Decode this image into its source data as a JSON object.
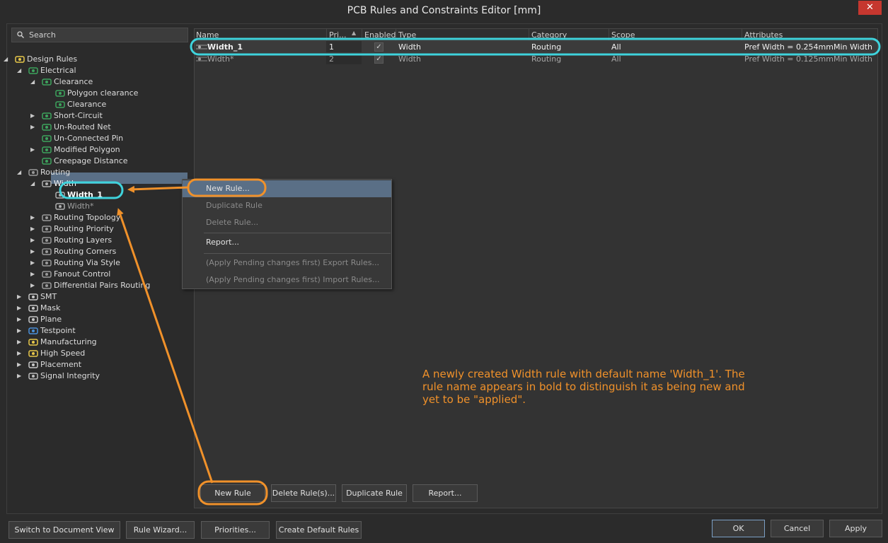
{
  "window": {
    "title": "PCB Rules and Constraints Editor [mm]",
    "close_glyph": "✕"
  },
  "search": {
    "label": "Search"
  },
  "tree": [
    {
      "label": "Design Rules",
      "icon": "design-rules-icon"
    },
    {
      "label": "Electrical",
      "icon": "electrical-icon"
    },
    {
      "label": "Clearance",
      "icon": "clearance-icon"
    },
    {
      "label": "Polygon clearance",
      "icon": "clearance-icon"
    },
    {
      "label": "Clearance",
      "icon": "clearance-icon"
    },
    {
      "label": "Short-Circuit",
      "icon": "short-circuit-icon"
    },
    {
      "label": "Un-Routed Net",
      "icon": "unrouted-net-icon"
    },
    {
      "label": "Un-Connected Pin",
      "icon": "unconnected-pin-icon"
    },
    {
      "label": "Modified Polygon",
      "icon": "modified-polygon-icon"
    },
    {
      "label": "Creepage Distance",
      "icon": "creepage-icon"
    },
    {
      "label": "Routing",
      "icon": "routing-icon"
    },
    {
      "label": "Width",
      "icon": "width-icon"
    },
    {
      "label": "Width_1",
      "icon": "width-icon"
    },
    {
      "label": "Width*",
      "icon": "width-icon"
    },
    {
      "label": "Routing Topology",
      "icon": "routing-icon"
    },
    {
      "label": "Routing Priority",
      "icon": "routing-icon"
    },
    {
      "label": "Routing Layers",
      "icon": "routing-icon"
    },
    {
      "label": "Routing Corners",
      "icon": "routing-icon"
    },
    {
      "label": "Routing Via Style",
      "icon": "routing-icon"
    },
    {
      "label": "Fanout Control",
      "icon": "routing-icon"
    },
    {
      "label": "Differential Pairs Routing",
      "icon": "routing-icon"
    },
    {
      "label": "SMT",
      "icon": "smt-icon"
    },
    {
      "label": "Mask",
      "icon": "mask-icon"
    },
    {
      "label": "Plane",
      "icon": "plane-icon"
    },
    {
      "label": "Testpoint",
      "icon": "testpoint-icon"
    },
    {
      "label": "Manufacturing",
      "icon": "manufacturing-icon"
    },
    {
      "label": "High Speed",
      "icon": "high-speed-icon"
    },
    {
      "label": "Placement",
      "icon": "placement-icon"
    },
    {
      "label": "Signal Integrity",
      "icon": "signal-integrity-icon"
    }
  ],
  "grid": {
    "columns": [
      "Name",
      "Pri...",
      "Enabled",
      "Type",
      "Category",
      "Scope",
      "Attributes"
    ],
    "rows": [
      {
        "name": "Width_1",
        "priority": "1",
        "enabled": true,
        "type": "Width",
        "category": "Routing",
        "scope": "All",
        "attr1": "Pref Width = 0.254mm",
        "attr2": "Min Width"
      },
      {
        "name": "Width*",
        "priority": "2",
        "enabled": true,
        "type": "Width",
        "category": "Routing",
        "scope": "All",
        "attr1": "Pref Width = 0.125mm",
        "attr2": "Min Width"
      }
    ]
  },
  "context_menu": {
    "new_rule": "New Rule...",
    "duplicate_rule": "Duplicate Rule",
    "delete_rule": "Delete Rule...",
    "report": "Report...",
    "export_rules": "(Apply Pending changes first) Export Rules...",
    "import_rules": "(Apply Pending changes first) Import Rules..."
  },
  "grid_buttons": {
    "new_rule": "New Rule",
    "delete_rules": "Delete Rule(s)...",
    "duplicate_rule": "Duplicate Rule",
    "report": "Report..."
  },
  "footer": {
    "switch_to_document_view": "Switch to Document View",
    "rule_wizard": "Rule Wizard...",
    "priorities": "Priorities...",
    "create_default_rules": "Create Default Rules",
    "ok": "OK",
    "cancel": "Cancel",
    "apply": "Apply"
  },
  "annotation": "A newly created Width rule with default name 'Width_1'. The rule name appears in bold to distinguish it as being new and yet to be \"applied\".",
  "colors": {
    "highlight_cyan": "#3fd3dc",
    "highlight_orange": "#f0912a",
    "selection": "#5a6f86",
    "close_button": "#c6372f"
  }
}
